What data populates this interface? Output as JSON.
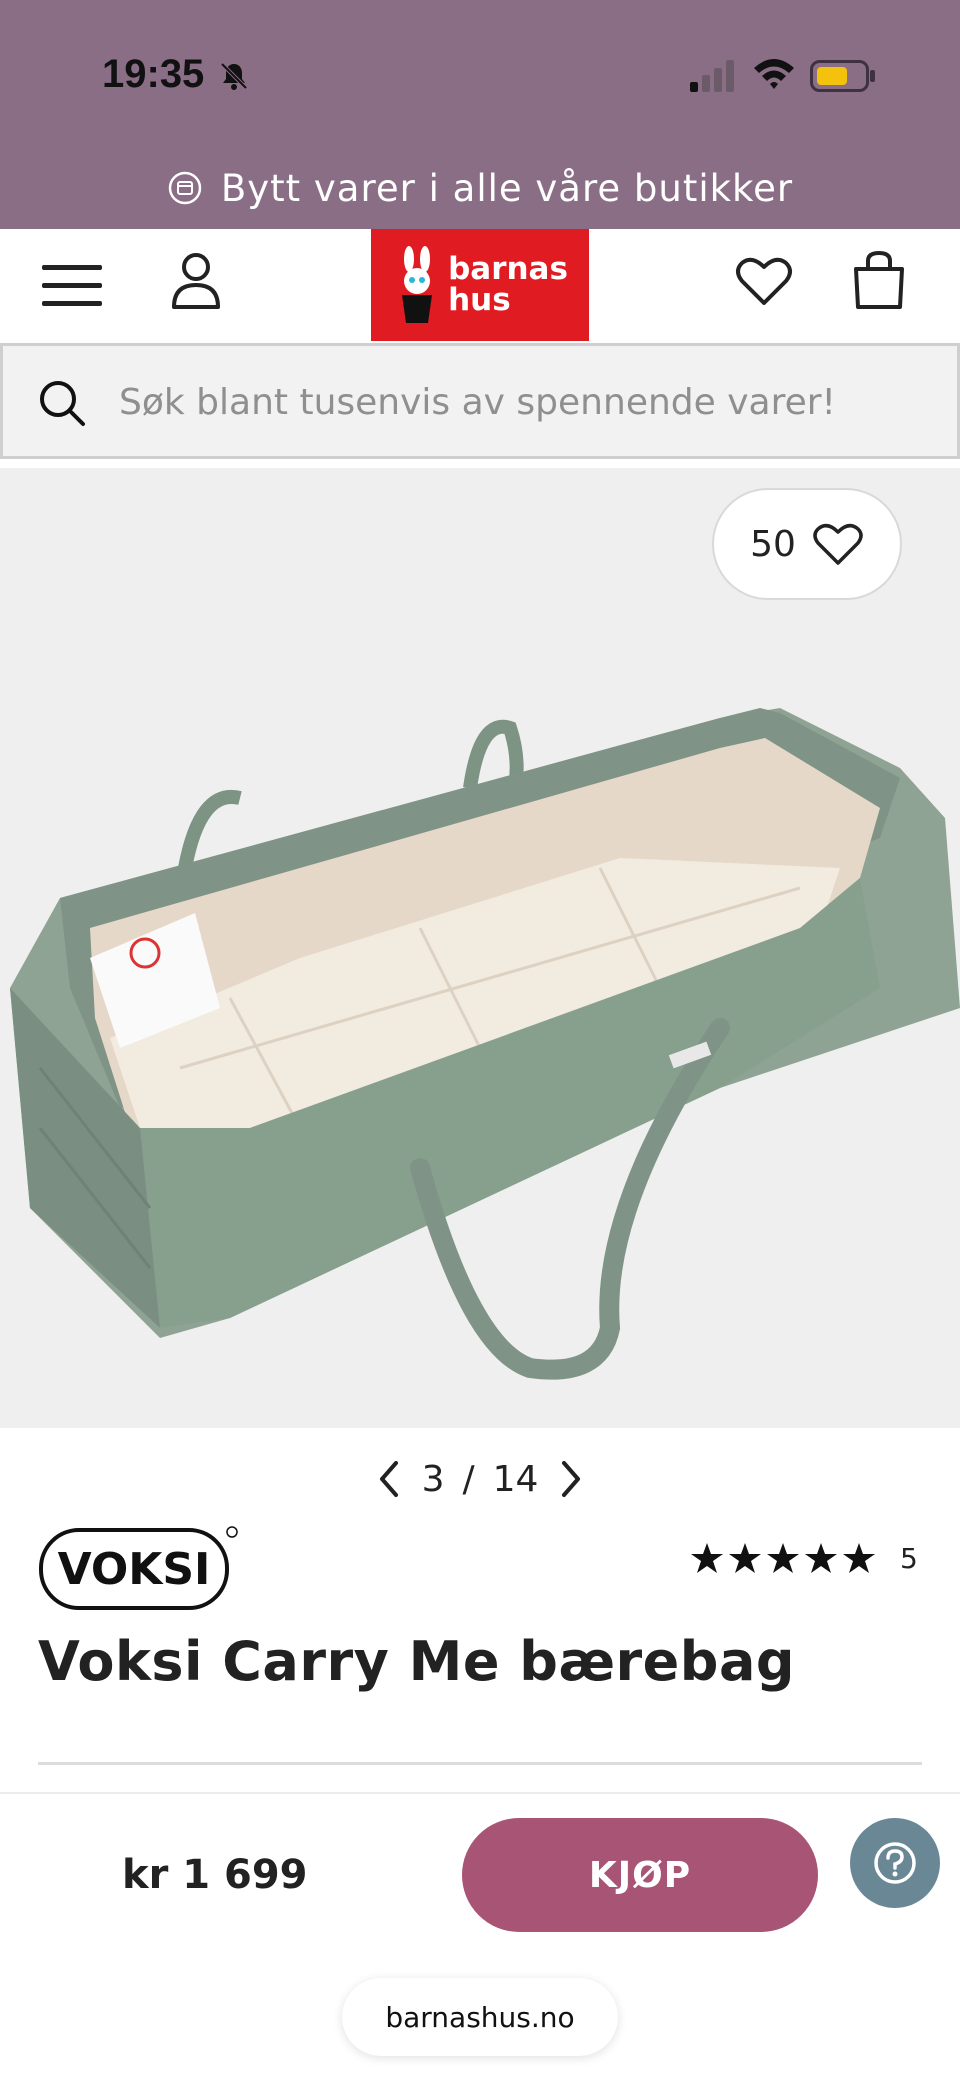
{
  "status_bar": {
    "time": "19:35",
    "icons": [
      "bell-off-icon",
      "signal-icon",
      "wifi-icon",
      "battery-icon"
    ]
  },
  "promo": {
    "text": "Bytt varer i alle våre butikker",
    "icon": "exchange-icon"
  },
  "header": {
    "logo_line1": "barnas",
    "logo_line2": "hus",
    "icons": [
      "menu-icon",
      "user-icon",
      "heart-icon",
      "shopping-bag-icon"
    ],
    "logo_color": "#e11b22"
  },
  "search": {
    "placeholder": "Søk blant tusenvis av spennende varer!"
  },
  "gallery": {
    "favorite_count": "50",
    "current": "3",
    "separator": "/",
    "total": "14"
  },
  "product": {
    "brand": "VOKSI",
    "title": "Voksi Carry Me bærebag",
    "rating_stars": 5,
    "rating_count": "5",
    "price": "kr 1 699"
  },
  "actions": {
    "buy_label": "KJØP",
    "help_icon": "question-icon"
  },
  "browser": {
    "url": "barnashus.no"
  },
  "colors": {
    "top_band": "#8a6e86",
    "buy_button": "#a85575",
    "help_button": "#6a8796"
  }
}
